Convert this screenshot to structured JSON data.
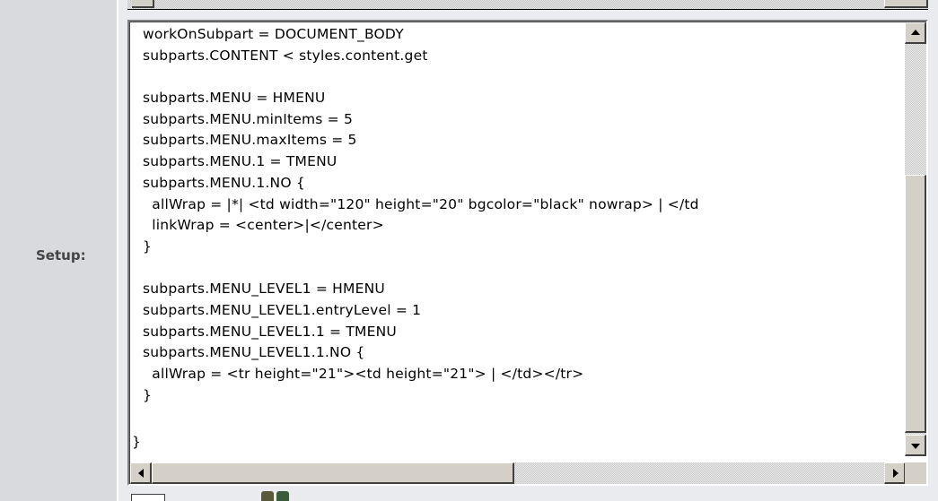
{
  "form": {
    "setup_label": "Setup:"
  },
  "editor": {
    "lines": [
      "workOnSubpart = DOCUMENT_BODY",
      "subparts.CONTENT < styles.content.get",
      "",
      "subparts.MENU = HMENU",
      "subparts.MENU.minItems = 5",
      "subparts.MENU.maxItems = 5",
      "subparts.MENU.1 = TMENU",
      "subparts.MENU.1.NO {",
      "  allWrap = |*| <td width=\"120\" height=\"20\" bgcolor=\"black\" nowrap> | </td",
      "  linkWrap = <center>|</center>",
      "}",
      "",
      "subparts.MENU_LEVEL1 = HMENU",
      "subparts.MENU_LEVEL1.entryLevel = 1",
      "subparts.MENU_LEVEL1.1 = TMENU",
      "subparts.MENU_LEVEL1.1.NO {",
      "  allWrap = <tr height=\"21\"><td height=\"21\"> | </td></tr>",
      "}",
      ""
    ],
    "last_line": "}"
  },
  "icons": {
    "scroll_up": "arrow-up",
    "scroll_down": "arrow-down",
    "scroll_left": "arrow-left",
    "scroll_right": "arrow-right"
  }
}
